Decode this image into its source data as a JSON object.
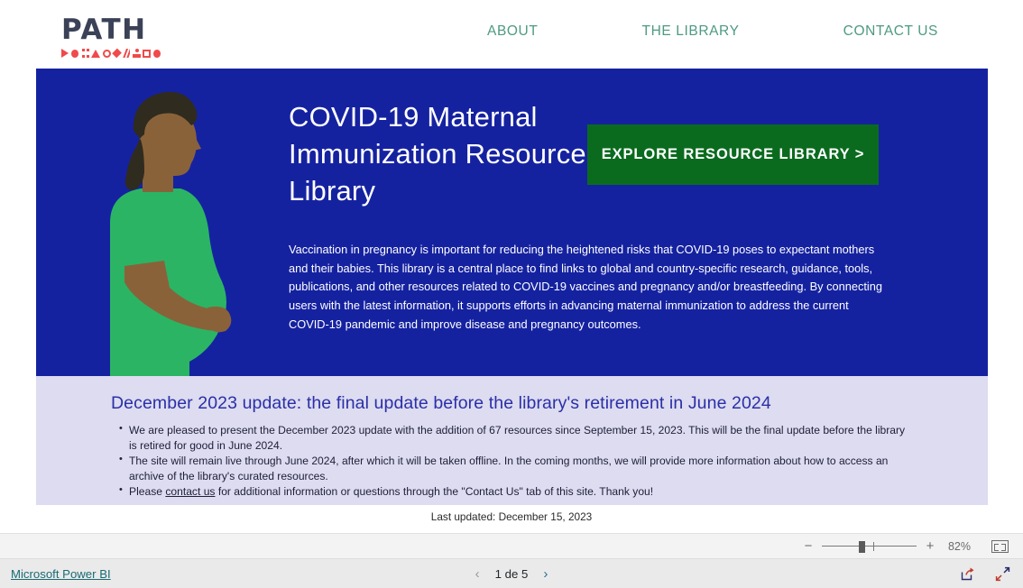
{
  "header": {
    "logo": {
      "word": "PATH",
      "glyph_row_name": "path-logo-symbols",
      "word_color": "#3b4257",
      "glyph_color": "#f04a4a"
    },
    "nav": [
      {
        "label": "ABOUT",
        "name": "nav-about"
      },
      {
        "label": "THE LIBRARY",
        "name": "nav-the-library"
      },
      {
        "label": "CONTACT US",
        "name": "nav-contact-us"
      }
    ],
    "nav_color": "#4d9a82"
  },
  "hero": {
    "background_color": "#1522a0",
    "title": "COVID-19 Maternal Immunization Resource Library",
    "cta_label": "EXPLORE RESOURCE LIBRARY >",
    "cta_color": "#0a6b1f",
    "body": "Vaccination in pregnancy is important for reducing the heightened risks that COVID-19 poses to expectant mothers and their babies. This library is a central place to find links to global and country-specific research, guidance, tools, publications, and other resources related to COVID-19 vaccines and pregnancy and/or breastfeeding. By connecting users with the latest information, it supports efforts in advancing maternal immunization to address the current COVID-19 pandemic and improve disease and pregnancy outcomes.",
    "illustration": {
      "name": "pregnant-woman-illustration",
      "hair_color": "#2f2b1f",
      "skin_color": "#8a6239",
      "shirt_color": "#2bb464"
    }
  },
  "update_section": {
    "background_color": "#dddcf0",
    "title": "December 2023 update: the final update before the library's retirement in June 2024",
    "title_color": "#2b2fa8",
    "bullets": [
      {
        "text_before": "We are pleased to present the December 2023 update with the addition of 67 resources since September 15, 2023. This will be the final update before the library is retired for good in June 2024.",
        "link": "",
        "text_after": ""
      },
      {
        "text_before": "The site will remain live through June 2024, after which it will be taken offline. In the coming months, we will provide more information about how to access an archive of the library's curated resources.",
        "link": "",
        "text_after": ""
      },
      {
        "text_before": "Please ",
        "link": "contact us",
        "text_after": " for additional information or questions through the \"Contact Us\" tab of this site. Thank you!"
      }
    ]
  },
  "last_updated": "Last updated: December 15, 2023",
  "zoom_bar": {
    "minus_label": "−",
    "plus_label": "+",
    "value": "82%",
    "fit_icon_name": "fit-to-page-icon"
  },
  "footer": {
    "brand": "Microsoft Power BI",
    "brand_color": "#1a6b74",
    "prev_arrow": "‹",
    "next_arrow": "›",
    "page_label": "1 de 5",
    "share_icon_name": "share-icon",
    "fullscreen_icon_name": "fullscreen-icon"
  }
}
